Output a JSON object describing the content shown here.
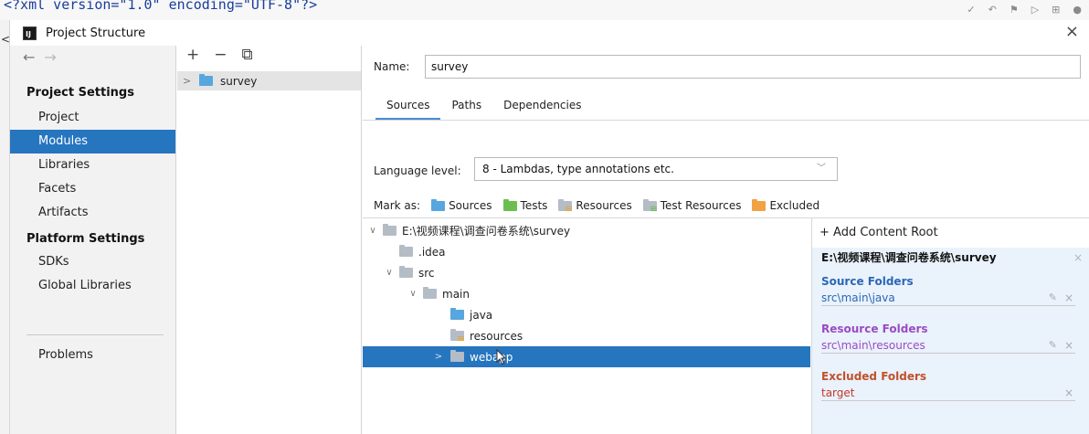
{
  "background_editor": {
    "code": "<?xml version=\"1.0\" encoding=\"UTF-8\"?>",
    "gutter_char": "<"
  },
  "dialog": {
    "title": "Project Structure",
    "close_glyph": "×"
  },
  "sidebar": {
    "back_arrow": "←",
    "forward_arrow": "→",
    "project_settings_title": "Project Settings",
    "project_items": [
      "Project",
      "Modules",
      "Libraries",
      "Facets",
      "Artifacts"
    ],
    "platform_settings_title": "Platform Settings",
    "platform_items": [
      "SDKs",
      "Global Libraries"
    ],
    "problems": "Problems",
    "selected": "Modules"
  },
  "modules": {
    "add_glyph": "+",
    "remove_glyph": "−",
    "copy_glyph": "⧉",
    "chevron": ">",
    "module_name": "survey"
  },
  "module_settings": {
    "name_label": "Name:",
    "name_value": "survey",
    "tabs": [
      "Sources",
      "Paths",
      "Dependencies"
    ],
    "active_tab": "Sources",
    "language_level_label": "Language level:",
    "language_level_value": "8 - Lambdas, type annotations etc.",
    "mark_as_label": "Mark as:",
    "mark_as": [
      "Sources",
      "Tests",
      "Resources",
      "Test Resources",
      "Excluded"
    ]
  },
  "tree": {
    "rows": [
      {
        "label": "E:\\视频课程\\调查问卷系统\\survey",
        "chevron": "∨",
        "folder": "gray"
      },
      {
        "label": ".idea",
        "chevron": "",
        "folder": "gray"
      },
      {
        "label": "src",
        "chevron": "∨",
        "folder": "gray"
      },
      {
        "label": "main",
        "chevron": "∨",
        "folder": "gray"
      },
      {
        "label": "java",
        "chevron": "",
        "folder": "blue"
      },
      {
        "label": "resources",
        "chevron": "",
        "folder": "res"
      },
      {
        "label": "webapp",
        "chevron": ">",
        "folder": "gray"
      }
    ],
    "selected": "webapp"
  },
  "content_roots": {
    "add_label": "+ Add Content Root",
    "root_path": "E:\\视频课程\\调查问卷系统\\survey",
    "source_folders_title": "Source Folders",
    "source_folders": [
      "src\\main\\java"
    ],
    "resource_folders_title": "Resource Folders",
    "resource_folders": [
      "src\\main\\resources"
    ],
    "excluded_folders_title": "Excluded Folders",
    "excluded_folders": [
      "target"
    ],
    "remove_glyph": "×",
    "edit_glyph": "✎"
  },
  "colors": {
    "selection": "#2675bf",
    "source": "#2a68b6",
    "resource": "#9a4bc4",
    "excluded": "#c0512b",
    "roots_bg": "#eaf2fb"
  }
}
